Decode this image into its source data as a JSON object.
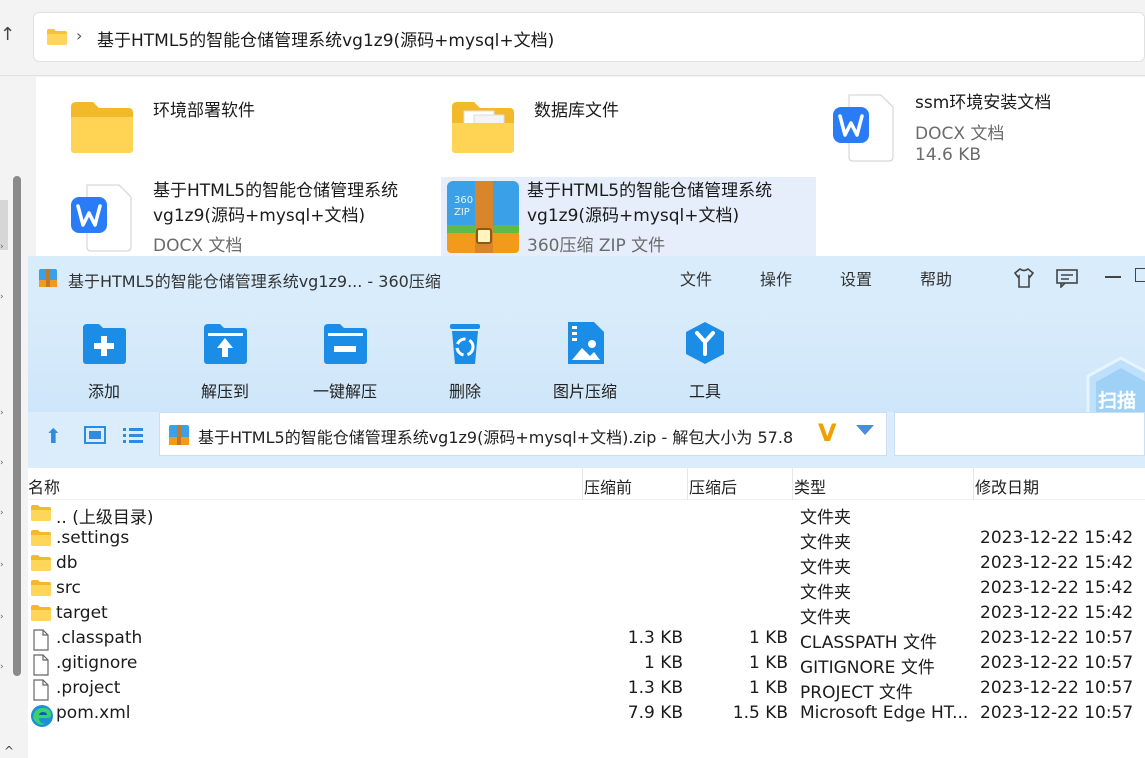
{
  "explorer": {
    "address_path": "基于HTML5的智能仓储管理系统vg1z9(源码+mysql+文档)",
    "items": [
      {
        "name": "环境部署软件",
        "sub1": "",
        "sub2": ""
      },
      {
        "name": "数据库文件",
        "sub1": "",
        "sub2": ""
      },
      {
        "name": "ssm环境安装文档",
        "sub1": "DOCX 文档",
        "sub2": "14.6 KB"
      },
      {
        "name": "基于HTML5的智能仓储管理系统vg1z9(源码+mysql+文档)",
        "sub1": "DOCX 文档",
        "sub2": ""
      },
      {
        "name": "基于HTML5的智能仓储管理系统vg1z9(源码+mysql+文档)",
        "sub1": "360压缩 ZIP 文件",
        "sub2": ""
      }
    ]
  },
  "zip": {
    "title": "基于HTML5的智能仓储管理系统vg1z9... - 360压缩",
    "menu": [
      "文件",
      "操作",
      "设置",
      "帮助"
    ],
    "toolbar": [
      "添加",
      "解压到",
      "一键解压",
      "删除",
      "图片压缩",
      "工具"
    ],
    "scan_label": "扫描",
    "path": "基于HTML5的智能仓储管理系统vg1z9(源码+mysql+文档).zip - 解包大小为 57.8",
    "columns": [
      "名称",
      "压缩前",
      "压缩后",
      "类型",
      "修改日期"
    ],
    "files": [
      {
        "name": ".. (上级目录)",
        "before": "",
        "after": "",
        "type": "文件夹",
        "date": "",
        "icon": "folder"
      },
      {
        "name": ".settings",
        "before": "",
        "after": "",
        "type": "文件夹",
        "date": "2023-12-22 15:42",
        "icon": "folder"
      },
      {
        "name": "db",
        "before": "",
        "after": "",
        "type": "文件夹",
        "date": "2023-12-22 15:42",
        "icon": "folder"
      },
      {
        "name": "src",
        "before": "",
        "after": "",
        "type": "文件夹",
        "date": "2023-12-22 15:42",
        "icon": "folder"
      },
      {
        "name": "target",
        "before": "",
        "after": "",
        "type": "文件夹",
        "date": "2023-12-22 15:42",
        "icon": "folder"
      },
      {
        "name": ".classpath",
        "before": "1.3 KB",
        "after": "1 KB",
        "type": "CLASSPATH 文件",
        "date": "2023-12-22 10:57",
        "icon": "file"
      },
      {
        "name": ".gitignore",
        "before": "1 KB",
        "after": "1 KB",
        "type": "GITIGNORE 文件",
        "date": "2023-12-22 10:57",
        "icon": "file"
      },
      {
        "name": ".project",
        "before": "1.3 KB",
        "after": "1 KB",
        "type": "PROJECT 文件",
        "date": "2023-12-22 10:57",
        "icon": "file"
      },
      {
        "name": "pom.xml",
        "before": "7.9 KB",
        "after": "1.5 KB",
        "type": "Microsoft Edge HT...",
        "date": "2023-12-22 10:57",
        "icon": "edge"
      }
    ]
  }
}
